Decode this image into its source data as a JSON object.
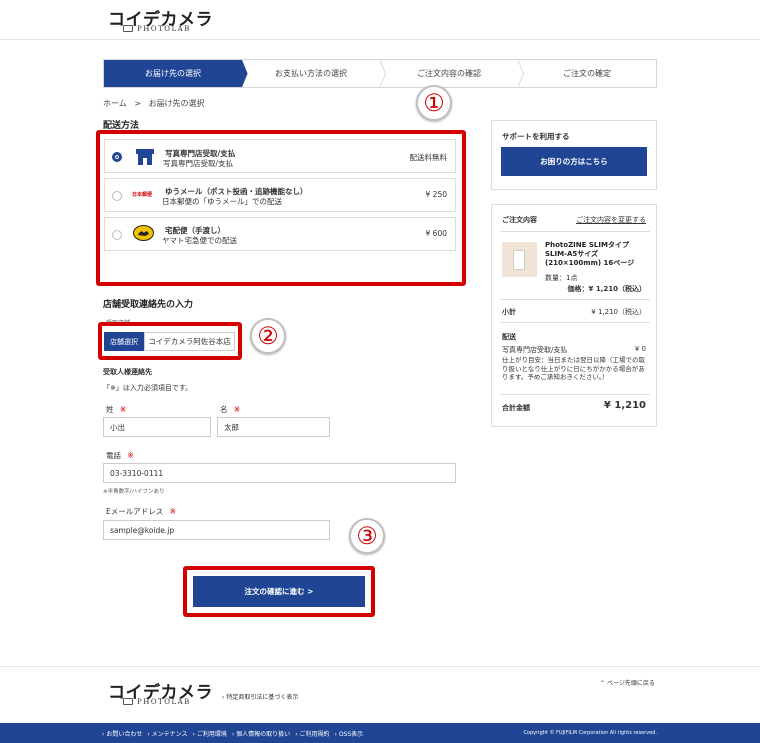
{
  "header": {
    "logo_main": "コイデカメラ",
    "logo_sub": "PHOTOLAB"
  },
  "steps": [
    {
      "label": "お届け先の選択",
      "active": true
    },
    {
      "label": "お支払い方法の選択",
      "active": false
    },
    {
      "label": "ご注文内容の確認",
      "active": false
    },
    {
      "label": "ご注文の確定",
      "active": false
    }
  ],
  "breadcrumb": {
    "home": "ホーム",
    "sep": ">",
    "current": "お届け先の選択"
  },
  "delivery": {
    "title": "配送方法",
    "options": [
      {
        "name": "写真専門店受取/支払",
        "desc": "写真専門店受取/支払",
        "price": "配送料無料",
        "selected": true,
        "icon": "store-icon"
      },
      {
        "name": "ゆうメール（ポスト投函・追跡機能なし）",
        "desc": "日本郵便の「ゆうメール」での配送",
        "price": "¥ 250",
        "selected": false,
        "icon": "japan-post-logo",
        "icon_text": "日本郵便"
      },
      {
        "name": "宅配便（手渡し）",
        "desc": "ヤマト宅急便での配送",
        "price": "¥ 600",
        "selected": false,
        "icon": "yamato-cat-icon"
      }
    ]
  },
  "store": {
    "title": "店舗受取連絡先の入力",
    "label": "受取店舗",
    "select_button": "店舗選択",
    "store_name": "コイデカメラ阿佐谷本店"
  },
  "recipient": {
    "title": "受取人様連絡先",
    "note": "「※」は入力必須項目です。",
    "last_name_label": "姓",
    "first_name_label": "名",
    "req_mark": "※",
    "last_name": "小出",
    "first_name": "太郎",
    "phone_label": "電話",
    "phone": "03-3310-0111",
    "phone_note": "※半角数字/ハイフンあり",
    "email_label": "Eメールアドレス",
    "email": "sample@koide.jp"
  },
  "submit_label": "注文の確認に進む >",
  "annotations": {
    "one": "①",
    "two": "②",
    "three": "③"
  },
  "sidebar": {
    "support_title": "サポートを利用する",
    "help_button": "お困りの方はこちら",
    "order_title": "ご注文内容",
    "change_link": "ご注文内容を変更する",
    "product_name": "PhotoZINE SLIMタイプ SLIM-A5サイズ(210×100mm) 16ページ",
    "qty": "数量：1点",
    "price": "価格：¥ 1,210（税込）",
    "subtotal_label": "小計",
    "subtotal": "¥ 1,210（税込）",
    "shipping_title": "配送",
    "shipping_method": "写真専門店受取/支払",
    "shipping_price": "¥ 0",
    "shipping_note": "仕上がり目安：当日または翌日以降（工場での取り扱いとなり仕上がりに日にちがかかる場合があります。予めご承知おきください。）",
    "total_label": "合計金額",
    "total": "¥ 1,210"
  },
  "footer": {
    "logo_main": "コイデカメラ",
    "logo_sub": "PHOTOLAB",
    "law_link": "特定商取引法に基づく表示",
    "top_link": "ページ先頭に戻る",
    "links": [
      "お問い合わせ",
      "メンテナンス",
      "ご利用環境",
      "個人情報の取り扱い",
      "ご利用規約",
      "OSS表示"
    ],
    "copyright": "Copyright © FUJIFILM Corporation All rights reserved."
  },
  "colors": {
    "brand_blue": "#1f4594",
    "annotation_red": "#d40000"
  }
}
